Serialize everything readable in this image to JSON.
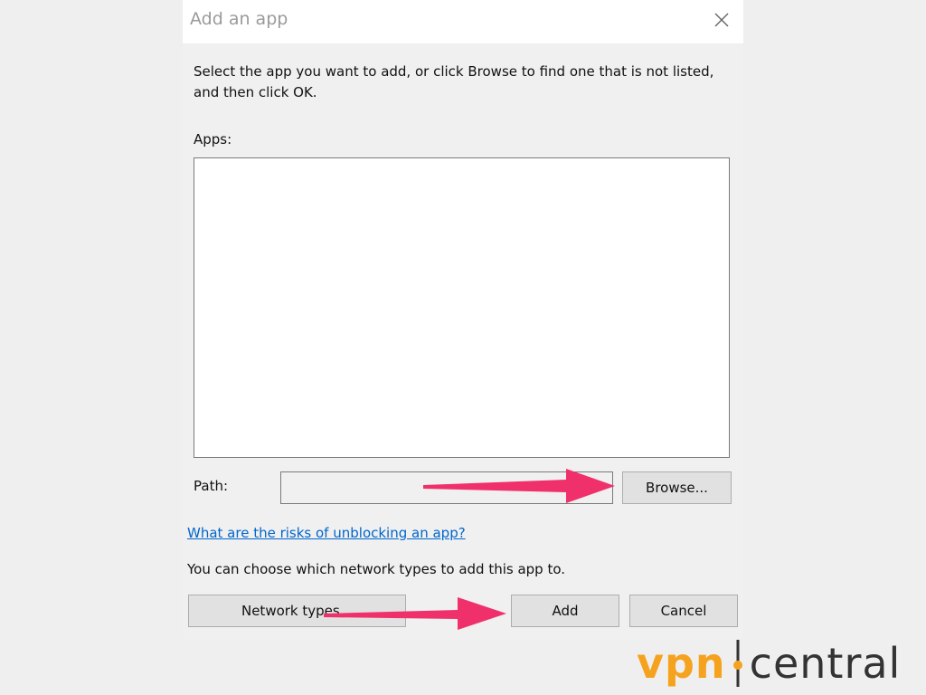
{
  "dialog": {
    "title": "Add an app",
    "instruction": "Select the app you want to add, or click Browse to find one that is not listed, and then click OK.",
    "apps_label": "Apps:",
    "path_label": "Path:",
    "path_value": "",
    "browse_label": "Browse...",
    "risk_link": "What are the risks of unblocking an app?",
    "network_text": "You can choose which network types to add this app to.",
    "network_types_label": "Network types...",
    "add_label": "Add",
    "cancel_label": "Cancel"
  },
  "watermark": {
    "brand_part1": "vpn",
    "brand_part2": "central"
  },
  "colors": {
    "arrow": "#f0306a",
    "link": "#0066cc",
    "brand_orange": "#f5a21e"
  }
}
